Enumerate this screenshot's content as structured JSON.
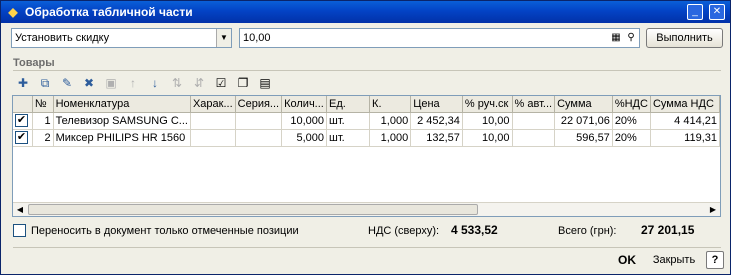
{
  "window": {
    "title": "Обработка табличной части"
  },
  "controls": {
    "action_value": "Установить скидку",
    "amount_value": "10,00",
    "run_label": "Выполнить"
  },
  "section": {
    "title": "Товары"
  },
  "toolbar_icons": [
    "add-icon",
    "copy-icon",
    "edit-icon",
    "delete-icon",
    "end-edit-icon",
    "move-up-icon",
    "move-down-icon",
    "sort-asc-icon",
    "sort-desc-icon",
    "check-all-icon",
    "uncheck-all-icon",
    "settings-icon"
  ],
  "table": {
    "headers": [
      "№",
      "Номенклатура",
      "Харак...",
      "Серия...",
      "Колич...",
      "Ед.",
      "К.",
      "Цена",
      "% руч.ск",
      "% авт...",
      "Сумма",
      "%НДС",
      "Сумма НДС"
    ],
    "rows": [
      {
        "checked": true,
        "n": "1",
        "name": "Телевизор SAMSUNG C...",
        "char": "",
        "series": "",
        "qty": "10,000",
        "unit": "шт.",
        "k": "1,000",
        "price": "2 452,34",
        "manual_disc": "10,00",
        "auto_disc": "",
        "sum": "22 071,06",
        "vat_rate": "20%",
        "vat_sum": "4 414,21"
      },
      {
        "checked": true,
        "n": "2",
        "name": "Миксер PHILIPS HR 1560",
        "char": "",
        "series": "",
        "qty": "5,000",
        "unit": "шт.",
        "k": "1,000",
        "price": "132,57",
        "manual_disc": "10,00",
        "auto_disc": "",
        "sum": "596,57",
        "vat_rate": "20%",
        "vat_sum": "119,31"
      }
    ]
  },
  "footer": {
    "transfer_label": "Переносить в документ только отмеченные позиции",
    "vat_label": "НДС (сверху):",
    "vat_value": "4 533,52",
    "total_label": "Всего (грн):",
    "total_value": "27 201,15",
    "ok_label": "OK",
    "close_label": "Закрыть",
    "help_label": "?"
  }
}
